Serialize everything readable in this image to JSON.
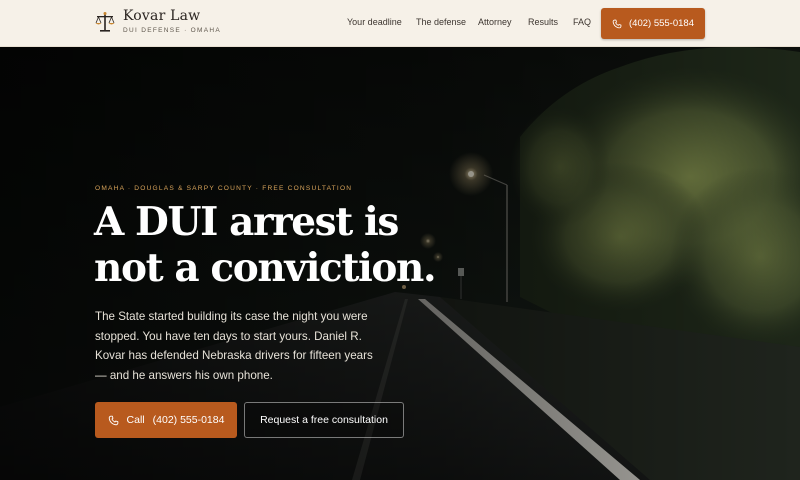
{
  "brand": {
    "name": "Kovar Law",
    "tagline": "DUI DEFENSE · OMAHA"
  },
  "nav": {
    "items": [
      "Your deadline",
      "The defense",
      "Attorney",
      "Results",
      "FAQ"
    ],
    "phone": "(402) 555-0184"
  },
  "hero": {
    "eyebrow": "OMAHA · DOUGLAS & SARPY COUNTY · FREE CONSULTATION",
    "headline_line1": "A DUI arrest is",
    "headline_line2": "not a conviction.",
    "lede": "The State started building its case the night you were stopped. You have ten days to start yours. Daniel R. Kovar has defended Nebraska drivers for fifteen years — and he answers his own phone.",
    "call_label": "Call",
    "call_number": "(402) 555-0184",
    "consult_label": "Request a free consultation"
  },
  "colors": {
    "accent": "#b85a1e",
    "header_bg": "#f6f1e8",
    "eyebrow": "#d7a35a"
  },
  "icons": [
    "scales-of-justice-icon",
    "phone-icon"
  ]
}
